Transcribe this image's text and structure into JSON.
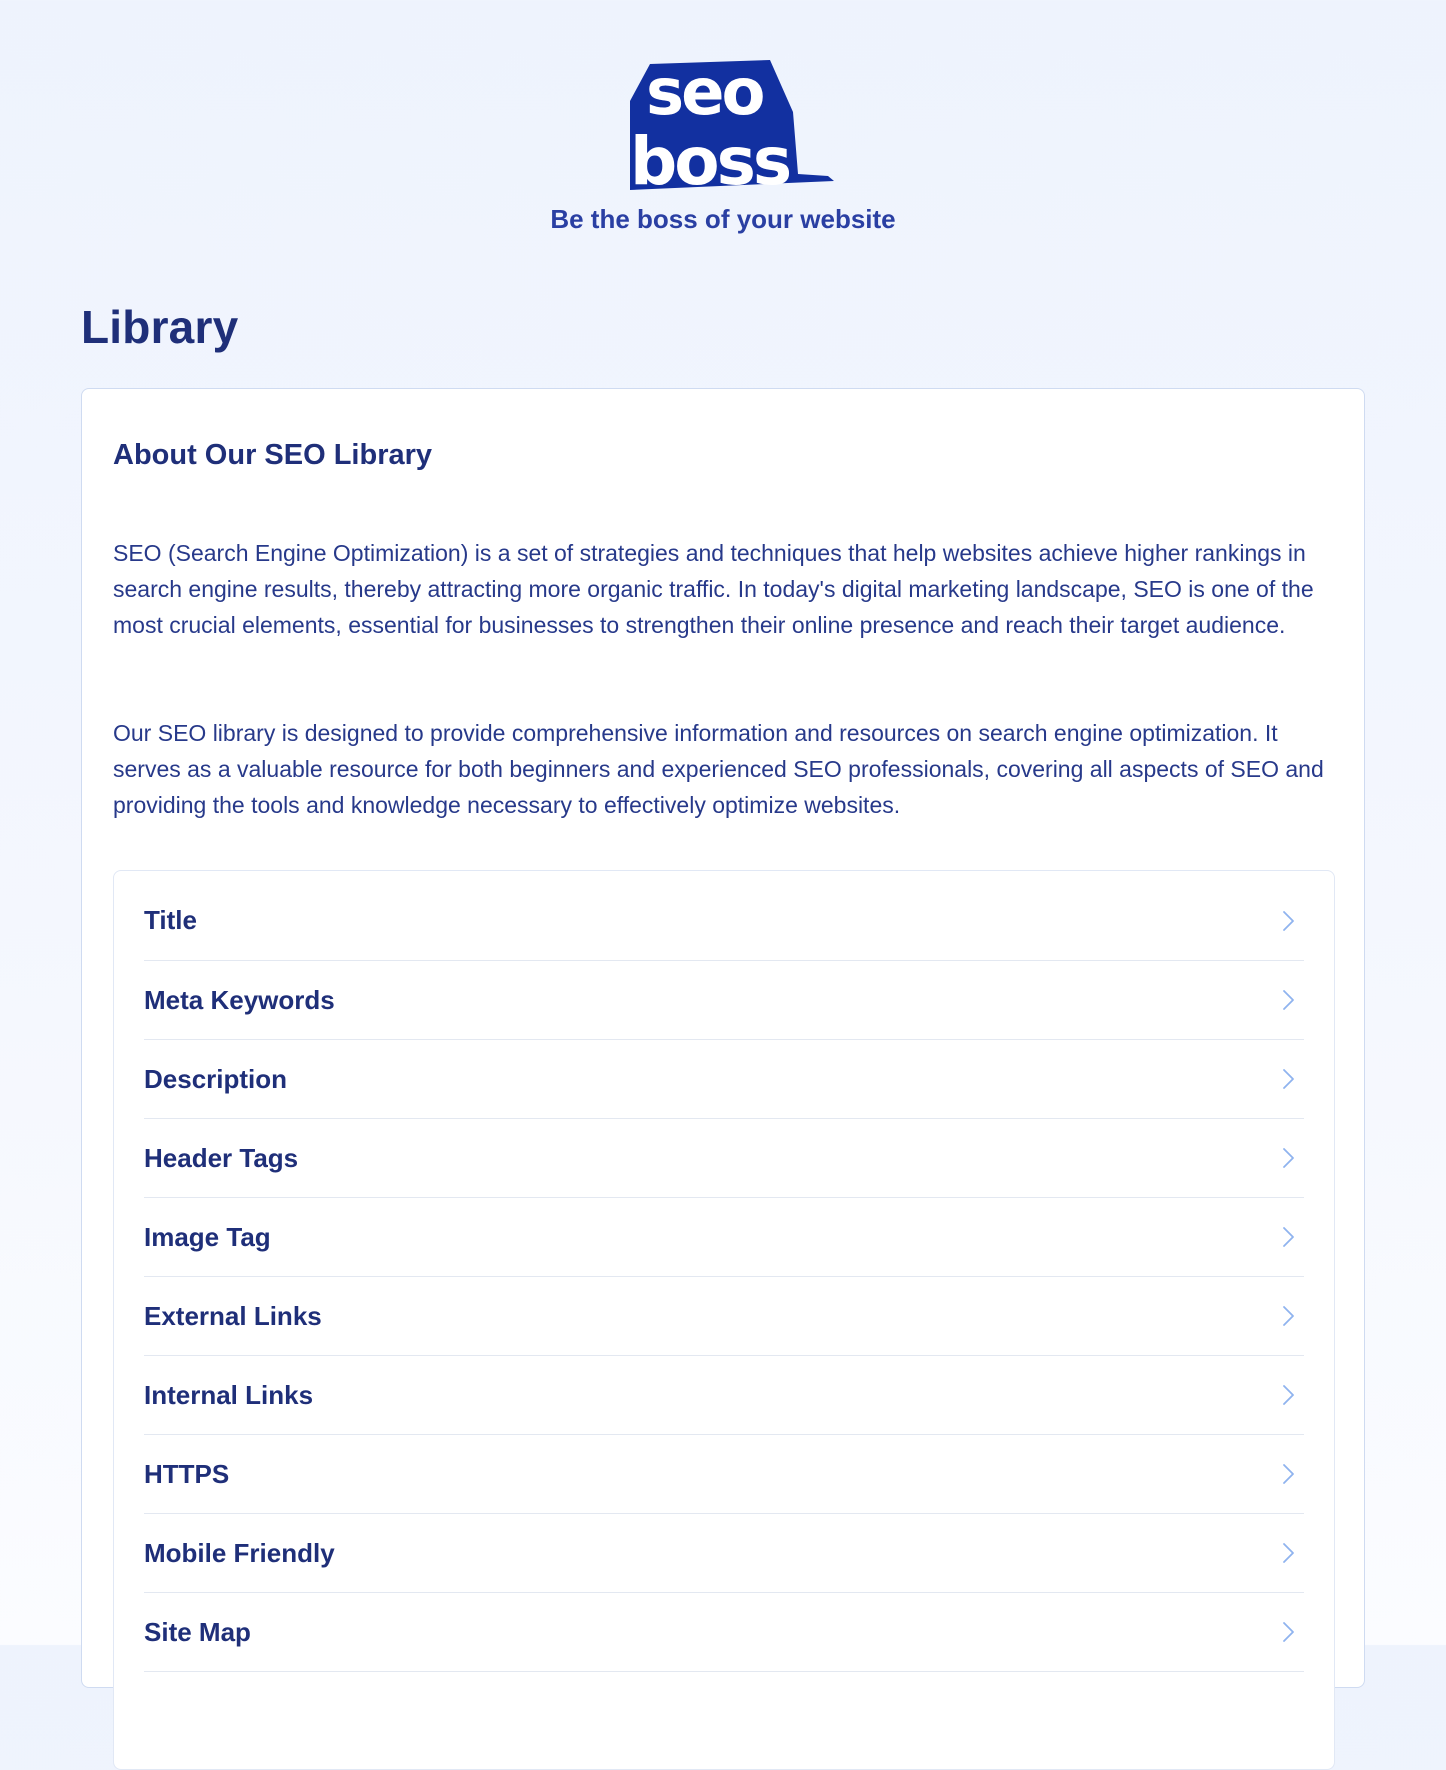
{
  "brand": {
    "logo_line_1": "seo",
    "logo_line_2": "boss",
    "tagline": "Be the boss of your website",
    "colors": {
      "primary": "#1230a0",
      "text": "#1f2f79",
      "tagline": "#2a3fa3",
      "chevron": "#8fb3ef"
    }
  },
  "page": {
    "title": "Library"
  },
  "about": {
    "title": "About Our SEO Library",
    "paragraphs": [
      "SEO (Search Engine Optimization) is a set of strategies and techniques that help websites achieve higher rankings in search engine results, thereby attracting more organic traffic. In today's digital marketing landscape, SEO is one of the most crucial elements, essential for businesses to strengthen their online presence and reach their target audience.",
      "Our SEO library is designed to provide comprehensive information and resources on search engine optimization. It serves as a valuable resource for both beginners and experienced SEO professionals, covering all aspects of SEO and providing the tools and knowledge necessary to effectively optimize websites."
    ]
  },
  "topics": {
    "icon": "chevron-right-icon",
    "items": [
      {
        "label": "Title"
      },
      {
        "label": "Meta Keywords"
      },
      {
        "label": "Description"
      },
      {
        "label": "Header Tags"
      },
      {
        "label": "Image Tag"
      },
      {
        "label": "External Links"
      },
      {
        "label": "Internal Links"
      },
      {
        "label": "HTTPS"
      },
      {
        "label": "Mobile Friendly"
      },
      {
        "label": "Site Map"
      }
    ]
  }
}
